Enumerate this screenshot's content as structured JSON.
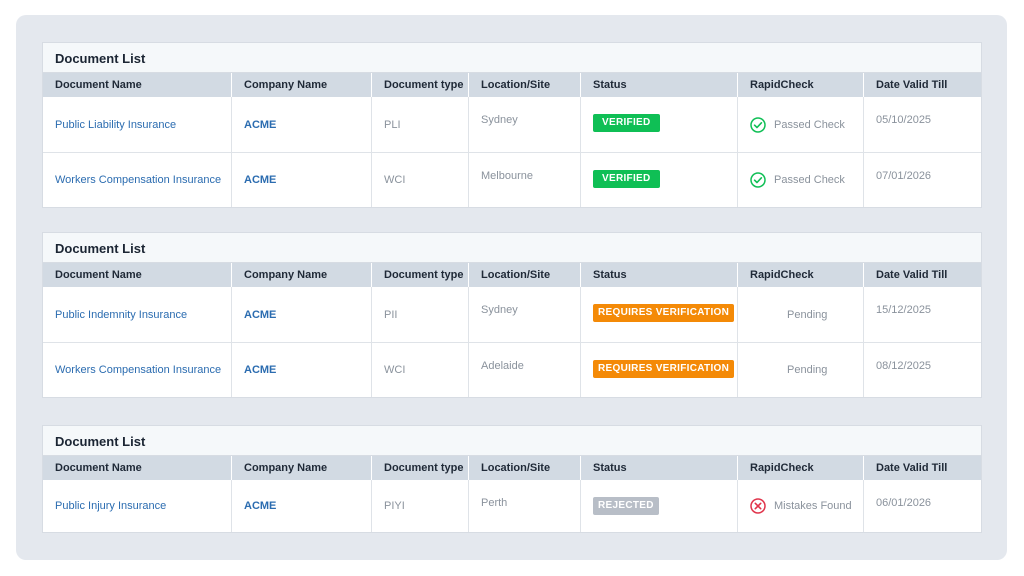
{
  "columns": [
    "Document Name",
    "Company Name",
    "Document type",
    "Location/Site",
    "Status",
    "RapidCheck",
    "Date Valid Till"
  ],
  "colors": {
    "verified": "#0fbf55",
    "requires": "#f48a07",
    "rejected": "#b8bec7",
    "link": "#2b6cb0",
    "passed_icon": "#0fbf55",
    "mistakes_icon": "#e0344b"
  },
  "cards": [
    {
      "title": "Document List",
      "rows": [
        {
          "doc": "Public Liability Insurance",
          "company": "ACME",
          "type": "PLI",
          "location": "Sydney",
          "status": "VERIFIED",
          "status_kind": "verified",
          "rapid": "Passed Check",
          "rapid_icon": "check-circle-icon",
          "date": "05/10/2025"
        },
        {
          "doc": "Workers Compensation Insurance",
          "company": "ACME",
          "type": "WCI",
          "location": "Melbourne",
          "status": "VERIFIED",
          "status_kind": "verified",
          "rapid": "Passed Check",
          "rapid_icon": "check-circle-icon",
          "date": "07/01/2026"
        }
      ]
    },
    {
      "title": "Document List",
      "rows": [
        {
          "doc": "Public Indemnity Insurance",
          "company": "ACME",
          "type": "PII",
          "location": "Sydney",
          "status": "REQUIRES VERIFICATION",
          "status_kind": "requires",
          "rapid": "Pending",
          "rapid_icon": "",
          "date": "15/12/2025"
        },
        {
          "doc": "Workers Compensation Insurance",
          "company": "ACME",
          "type": "WCI",
          "location": "Adelaide",
          "status": "REQUIRES VERIFICATION",
          "status_kind": "requires",
          "rapid": "Pending",
          "rapid_icon": "",
          "date": "08/12/2025"
        }
      ]
    },
    {
      "title": "Document List",
      "rows": [
        {
          "doc": "Public Injury Insurance",
          "company": "ACME",
          "type": "PIYI",
          "location": "Perth",
          "status": "REJECTED",
          "status_kind": "rejected",
          "rapid": "Mistakes Found",
          "rapid_icon": "x-circle-icon",
          "date": "06/01/2026"
        }
      ]
    }
  ]
}
